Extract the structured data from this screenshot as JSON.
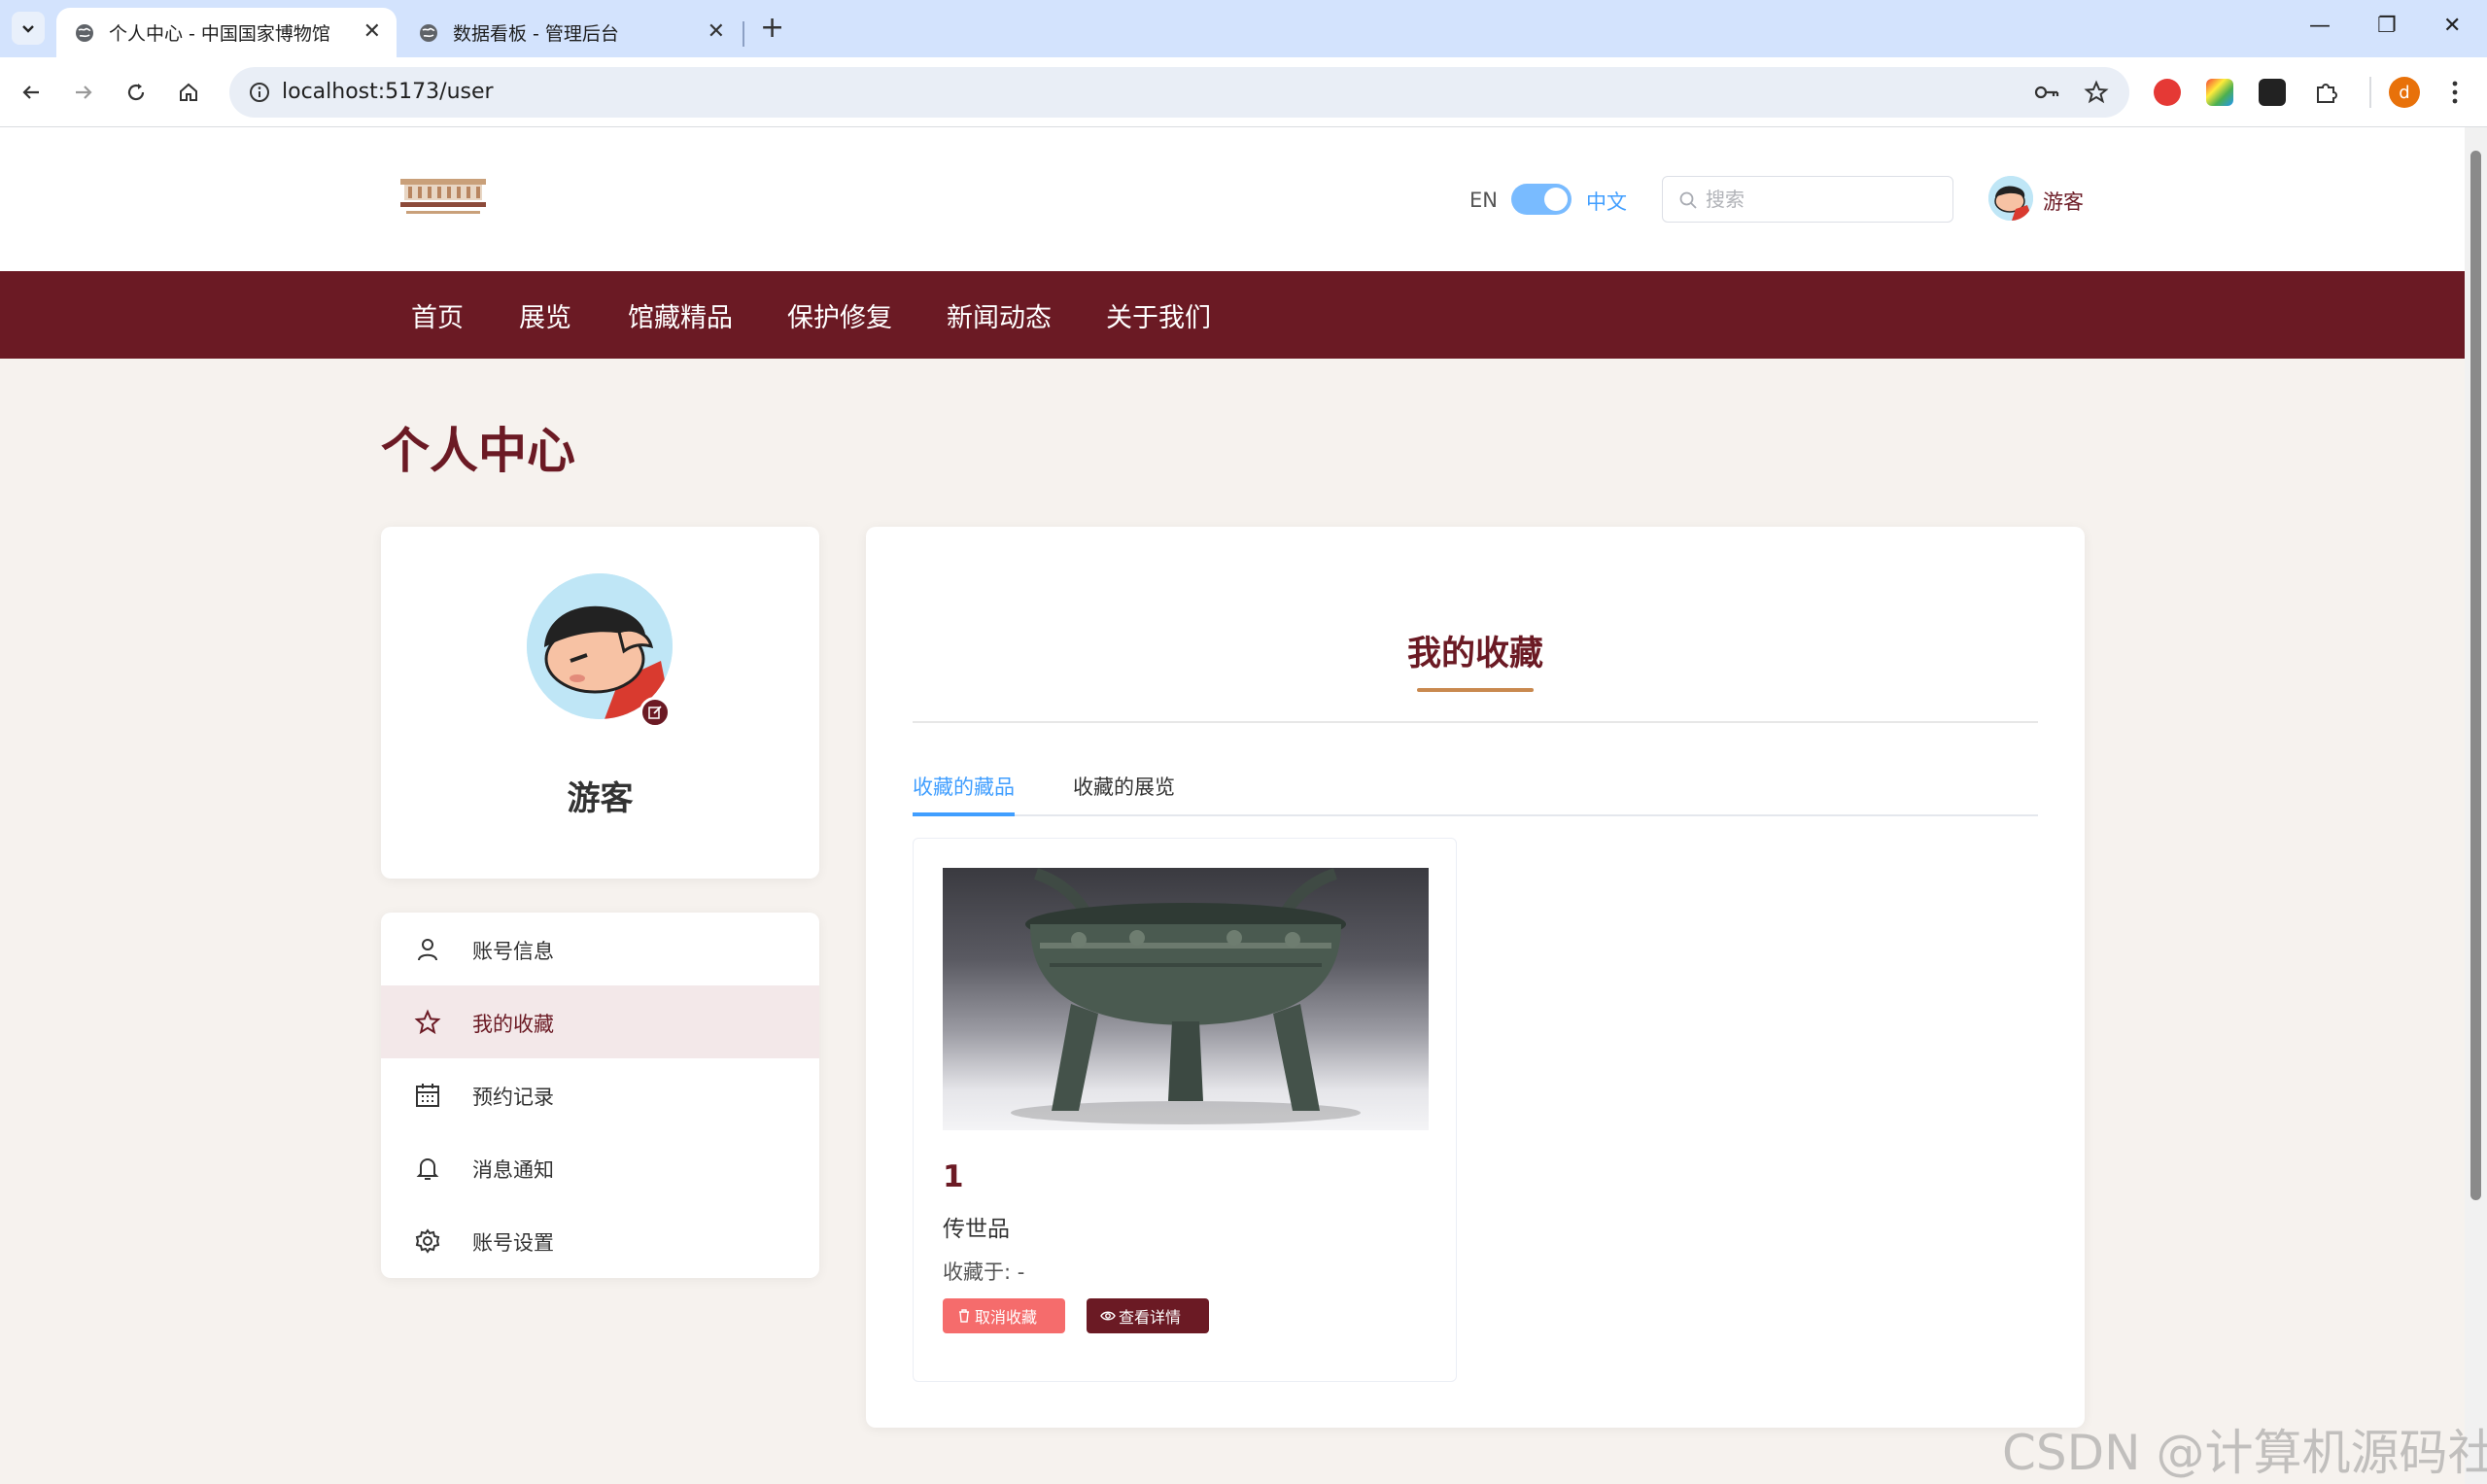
{
  "browser": {
    "tabs": [
      {
        "title": "个人中心 - 中国国家博物馆",
        "active": true
      },
      {
        "title": "数据看板 - 管理后台",
        "active": false
      }
    ],
    "close_glyph": "✕",
    "new_tab_glyph": "+",
    "url": "localhost:5173/user",
    "window_controls": {
      "minimize": "—",
      "restore": "❐",
      "close": "✕"
    },
    "profile_initial": "d"
  },
  "header": {
    "lang_en": "EN",
    "lang_zh": "中文",
    "search_placeholder": "搜索",
    "user_name": "游客"
  },
  "nav": {
    "items": [
      "首页",
      "展览",
      "馆藏精品",
      "保护修复",
      "新闻动态",
      "关于我们"
    ]
  },
  "page": {
    "title": "个人中心"
  },
  "profile": {
    "name": "游客"
  },
  "menu": {
    "items": [
      {
        "label": "账号信息",
        "icon": "user-icon"
      },
      {
        "label": "我的收藏",
        "icon": "star-icon",
        "active": true
      },
      {
        "label": "预约记录",
        "icon": "calendar-icon"
      },
      {
        "label": "消息通知",
        "icon": "bell-icon"
      },
      {
        "label": "账号设置",
        "icon": "gear-icon"
      }
    ]
  },
  "favorites": {
    "title": "我的收藏",
    "tabs": [
      "收藏的藏品",
      "收藏的展览"
    ],
    "active_tab": 0,
    "items": [
      {
        "id": "1",
        "name": "传世品",
        "collected_at": "收藏于: -",
        "unfav_label": "取消收藏",
        "detail_label": "查看详情"
      }
    ]
  },
  "colors": {
    "brand": "#6b1a24",
    "accent": "#409eff",
    "danger": "#f56c6c",
    "gold": "#c9894f"
  },
  "watermark": "CSDN @计算机源码社"
}
